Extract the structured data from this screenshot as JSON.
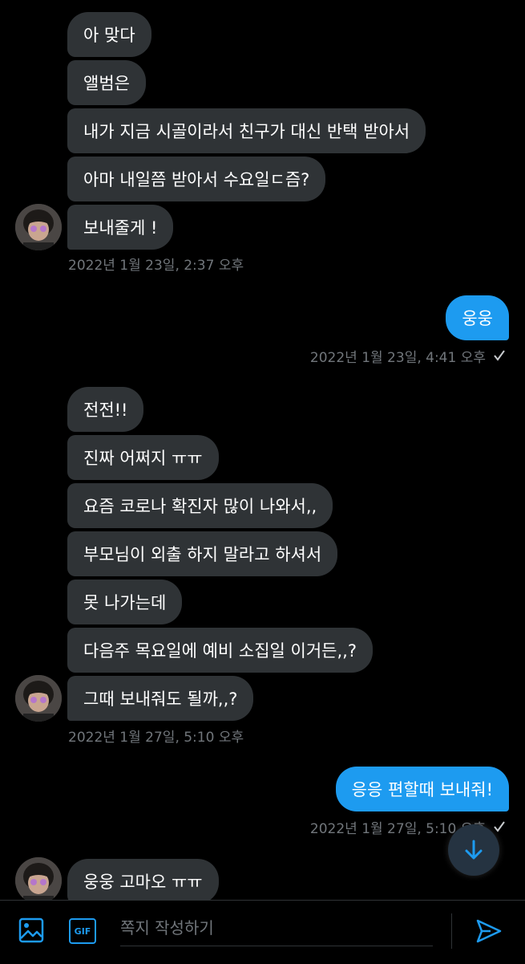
{
  "colors": {
    "background": "#000000",
    "incoming_bubble": "#2f3336",
    "outgoing_bubble": "#1d9bf0",
    "timestamp": "#71767b",
    "accent": "#1d9bf0"
  },
  "conversation": {
    "group1": {
      "messages": [
        "아 맞다",
        "앨범은",
        "내가 지금 시골이라서 친구가 대신 반택 받아서",
        "아마 내일쯤 받아서 수요일ㄷ즘?",
        "보내줄게 !"
      ],
      "timestamp": "2022년 1월 23일, 2:37 오후"
    },
    "group2": {
      "messages": [
        "웅웅"
      ],
      "timestamp": "2022년 1월 23일, 4:41 오후"
    },
    "group3": {
      "messages": [
        "전전!!",
        "진짜 어쩌지 ㅠㅠ",
        "요즘 코로나 확진자 많이 나와서,,",
        "부모님이 외출 하지 말라고 하셔서",
        "못 나가는데",
        "다음주 목요일에 예비 소집일 이거든,,?",
        "그때 보내줘도 될까,,?"
      ],
      "timestamp": "2022년 1월 27일, 5:10 오후"
    },
    "group4": {
      "messages": [
        "응응 편할때 보내줘!"
      ],
      "timestamp": "2022년 1월 27일, 5:10 오후"
    },
    "group5": {
      "messages": [
        "웅웅 고마오 ㅠㅠ"
      ]
    }
  },
  "icons": {
    "read_receipt": "check-icon",
    "scroll_down": "arrow-down-icon",
    "image": "image-icon",
    "gif": "gif-icon",
    "send": "send-icon"
  },
  "composer": {
    "gif_label": "GIF",
    "placeholder": "쪽지 작성하기"
  }
}
